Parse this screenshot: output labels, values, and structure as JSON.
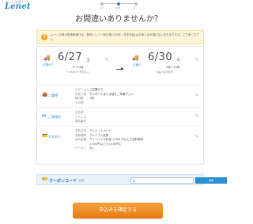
{
  "app": {
    "logo": "Lenet",
    "logo_sub": "ネット宅配クリーニング"
  },
  "steps": [
    {
      "label": "入力"
    },
    {
      "label": "確認"
    },
    {
      "label": "完了"
    }
  ],
  "page": {
    "title": "お間違いありませんか？"
  },
  "notice": {
    "icon": "!",
    "text": "よーく日時の配達候補日は、集荷として一部日程(土日祝・年末年始)はお申し込み頂けない日もあります。ご了承ください。"
  },
  "schedule": {
    "pickup": {
      "caption": "お預かり",
      "date": "6/27",
      "dow": "土",
      "time": "9～13時",
      "address": "〒2360017 埼玉県 2-"
    },
    "delivery": {
      "caption": "お届け",
      "date": "6/30",
      "dow": "火",
      "time": "9時～12時",
      "address": "お届け先同住所"
    }
  },
  "sections": {
    "request": {
      "title": "ご要望",
      "rows": [
        {
          "k": "オプション",
          "v": "ご記載から"
        },
        {
          "k": "引取り袋",
          "v": "ダンボールまたは袋をご準備下さい"
        },
        {
          "k": "個口数",
          "v": "1個"
        },
        {
          "k": "その他",
          "v": ""
        }
      ]
    },
    "contact": {
      "title": "ご連絡先",
      "rows": [
        {
          "k": "お名前",
          "v": ""
        },
        {
          "k": "アドレス",
          "v": ""
        },
        {
          "k": "電話番号",
          "v": ""
        }
      ]
    },
    "payment": {
      "title": "お支払い",
      "rows": [
        {
          "k": "支払方法",
          "v": "クレジットカード"
        },
        {
          "k": "会員種別",
          "v": "プレミアム会員"
        },
        {
          "k": "合計金額",
          "v": "クリーニング料金 1,900 円以上で送料無料"
        },
        {
          "k": "",
          "v": "1,500円以上で1,400円に"
        },
        {
          "k": "クーポン",
          "v": "なし"
        }
      ]
    }
  },
  "coupon": {
    "label": "クーポンコード",
    "note": "（任意）",
    "value": "1",
    "apply_label": "適用"
  },
  "confirm": {
    "label": "申込みを確定する"
  },
  "colors": {
    "accent": "#2a8fd0",
    "cta": "#f08a1c",
    "notice_bg": "#fff6d8"
  }
}
